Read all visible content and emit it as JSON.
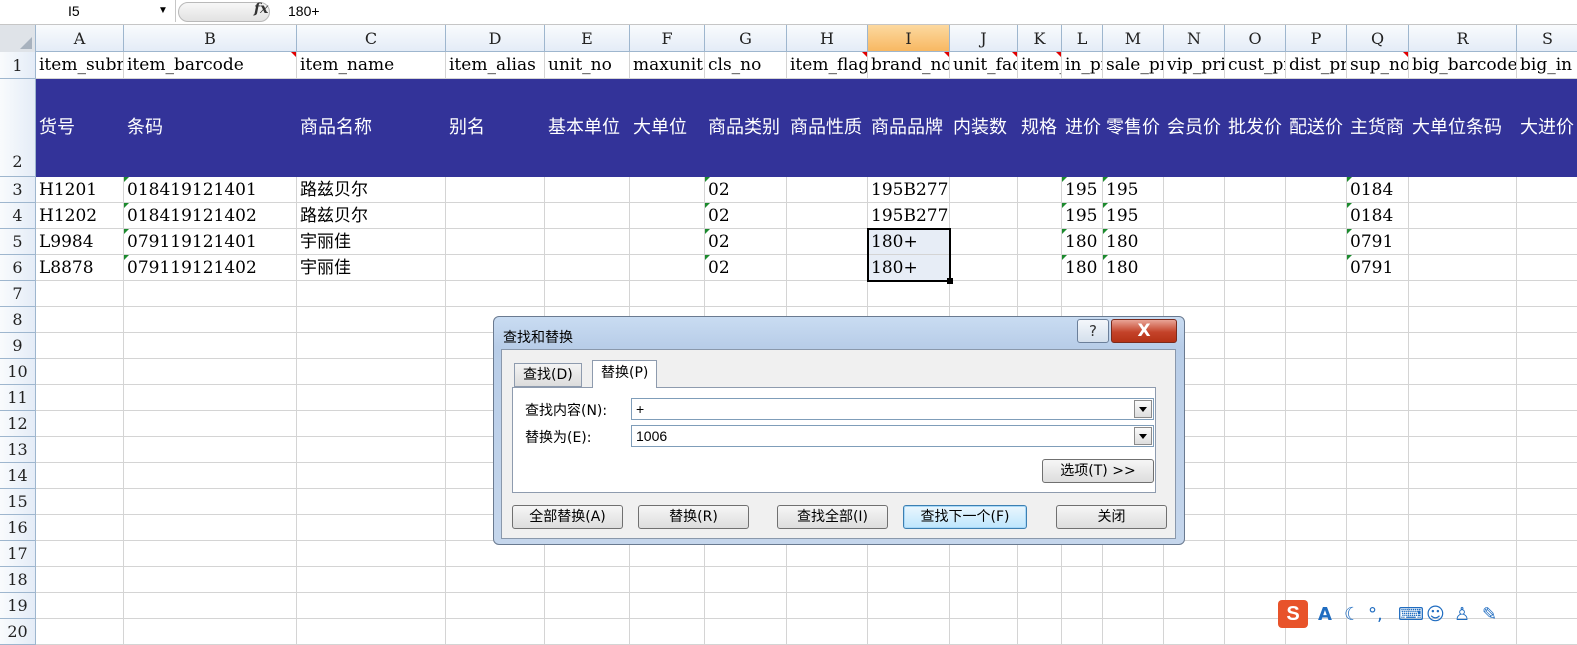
{
  "formula_bar": {
    "name_box": "I5",
    "fx_label": "fx",
    "content": "180+"
  },
  "columns": [
    "A",
    "B",
    "C",
    "D",
    "E",
    "F",
    "G",
    "H",
    "I",
    "J",
    "K",
    "L",
    "M",
    "N",
    "O",
    "P",
    "Q",
    "R",
    "S"
  ],
  "rows": [
    "1",
    "2",
    "3",
    "4",
    "5",
    "6",
    "7",
    "8",
    "9",
    "10",
    "11",
    "12",
    "13",
    "14",
    "15",
    "16",
    "17",
    "18",
    "19",
    "20"
  ],
  "field_row": [
    "item_subno",
    "item_barcode",
    "item_name",
    "item_alias",
    "unit_no",
    "maxunit",
    "cls_no",
    "item_flag",
    "brand_no",
    "unit_factor",
    "item_size",
    "in_price",
    "sale_price",
    "vip_price",
    "cust_price",
    "dist_price",
    "sup_no",
    "big_barcode",
    "big_in"
  ],
  "label_row": [
    "货号",
    "条码",
    "商品名称",
    "别名",
    "基本单位",
    "大单位",
    "商品类别",
    "商品性质",
    "商品品牌",
    "内装数",
    "规格",
    "进价",
    "零售价",
    "会员价",
    "批发价",
    "配送价",
    "主货商",
    "大单位条码",
    "大进价"
  ],
  "data_rows": [
    [
      "H1201",
      "018419121401",
      "路兹贝尔",
      "",
      "",
      "",
      "02",
      "",
      "195B277",
      "",
      "",
      "195",
      "195",
      "",
      "",
      "",
      "0184",
      "",
      ""
    ],
    [
      "H1202",
      "018419121402",
      "路兹贝尔",
      "",
      "",
      "",
      "02",
      "",
      "195B277",
      "",
      "",
      "195",
      "195",
      "",
      "",
      "",
      "0184",
      "",
      ""
    ],
    [
      "L9984",
      "079119121401",
      "宇丽佳",
      "",
      "",
      "",
      "02",
      "",
      "180+",
      "",
      "",
      "180",
      "180",
      "",
      "",
      "",
      "0791",
      "",
      ""
    ],
    [
      "L8878",
      "079119121402",
      "宇丽佳",
      "",
      "",
      "",
      "02",
      "",
      "180+",
      "",
      "",
      "180",
      "180",
      "",
      "",
      "",
      "0791",
      "",
      ""
    ]
  ],
  "dialog": {
    "title": "查找和替换",
    "help_label": "?",
    "close_label": "X",
    "tabs": [
      {
        "label": "查找(D)"
      },
      {
        "label": "替换(P)"
      }
    ],
    "find_label": "查找内容(N):",
    "find_value": "+",
    "replace_label": "替换为(E):",
    "replace_value": "1006",
    "options_label": "选项(T) >>",
    "buttons": {
      "replace_all": "全部替换(A)",
      "replace": "替换(R)",
      "find_all": "查找全部(I)",
      "find_next": "查找下一个(F)",
      "close": "关闭"
    }
  },
  "ime": {
    "logo": "S",
    "mode": "A"
  },
  "colors": {
    "header_fill": "#333399",
    "selected_col": "#f8b862",
    "close_red": "#c4432a"
  }
}
